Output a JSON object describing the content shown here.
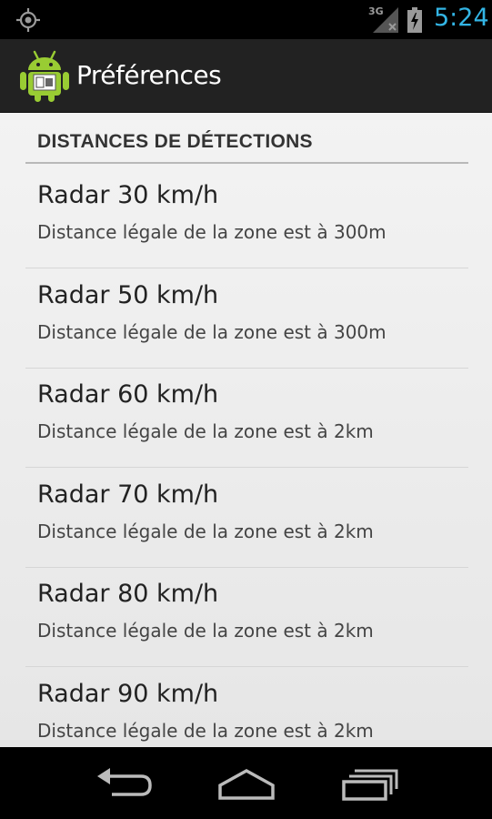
{
  "status_bar": {
    "time": "5:24",
    "network": "3G",
    "accent_color": "#33b5e5",
    "icons": [
      "gps-icon",
      "signal-icon",
      "battery-charging-icon"
    ]
  },
  "action_bar": {
    "title": "Préférences",
    "icon": "android-app-icon"
  },
  "preferences": {
    "category": "DISTANCES DE DÉTECTIONS",
    "items": [
      {
        "title": "Radar 30 km/h",
        "summary": "Distance légale de la zone est à 300m"
      },
      {
        "title": "Radar 50 km/h",
        "summary": "Distance légale de la zone est à 300m"
      },
      {
        "title": "Radar 60 km/h",
        "summary": "Distance légale de la zone est à 2km"
      },
      {
        "title": "Radar 70 km/h",
        "summary": "Distance légale de la zone est à 2km"
      },
      {
        "title": "Radar 80 km/h",
        "summary": "Distance légale de la zone est à 2km"
      },
      {
        "title": "Radar 90 km/h",
        "summary": "Distance légale de la zone est à 2km"
      }
    ]
  },
  "nav_bar": {
    "icons": [
      "back-icon",
      "home-icon",
      "recent-apps-icon"
    ]
  }
}
